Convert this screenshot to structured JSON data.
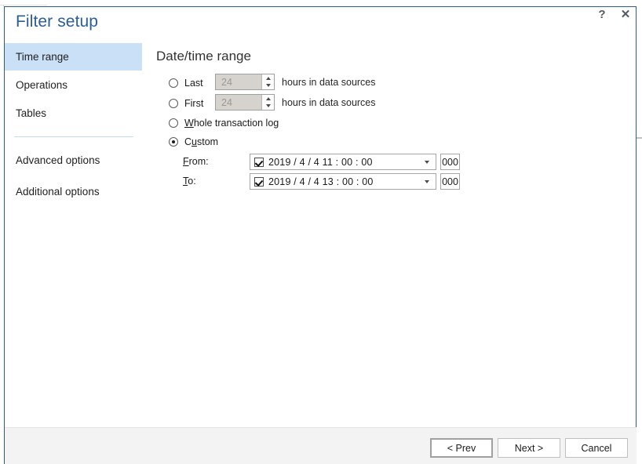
{
  "window": {
    "title": "Filter setup",
    "help_icon": "question-mark-icon",
    "close_icon": "close-x-icon",
    "help_label": "?",
    "close_label": "✕"
  },
  "sidebar": {
    "items": [
      {
        "label": "Time range",
        "active": true
      },
      {
        "label": "Operations",
        "active": false
      },
      {
        "label": "Tables",
        "active": false
      }
    ],
    "extra_items": [
      {
        "label": "Advanced options"
      },
      {
        "label": "Additional options"
      }
    ]
  },
  "main": {
    "heading": "Date/time range",
    "options": [
      {
        "id": "last",
        "label": "Last",
        "selected": false,
        "spinner_value": "24",
        "units": "hours in data sources"
      },
      {
        "id": "first",
        "label": "First",
        "selected": false,
        "spinner_value": "24",
        "units": "hours in data sources"
      },
      {
        "id": "whole",
        "label_prefix": "",
        "label_accel": "W",
        "label_suffix": "hole transaction log",
        "selected": false
      },
      {
        "id": "custom",
        "label_prefix": "C",
        "label_accel": "u",
        "label_suffix": "stom",
        "selected": true
      }
    ],
    "custom_rows": [
      {
        "id": "from",
        "label_accel": "F",
        "label_suffix": "rom:",
        "checked": true,
        "datetime": "2019 /  4 /  4    11 : 00 : 00",
        "milliseconds": "000"
      },
      {
        "id": "to",
        "label_accel": "T",
        "label_suffix": "o:",
        "checked": true,
        "datetime": "2019 /  4 /  4    13 : 00 : 00",
        "milliseconds": "000"
      }
    ]
  },
  "footer": {
    "buttons": [
      {
        "id": "prev",
        "label": "< Prev",
        "default": true
      },
      {
        "id": "next",
        "label": "Next >",
        "default": false
      },
      {
        "id": "cancel",
        "label": "Cancel",
        "default": false
      }
    ]
  },
  "colors": {
    "accent_title": "#2a5e99",
    "sidebar_active": "#c9e0f7",
    "window_border": "#2f5b8b",
    "footer_bg": "#f3f3f3"
  }
}
